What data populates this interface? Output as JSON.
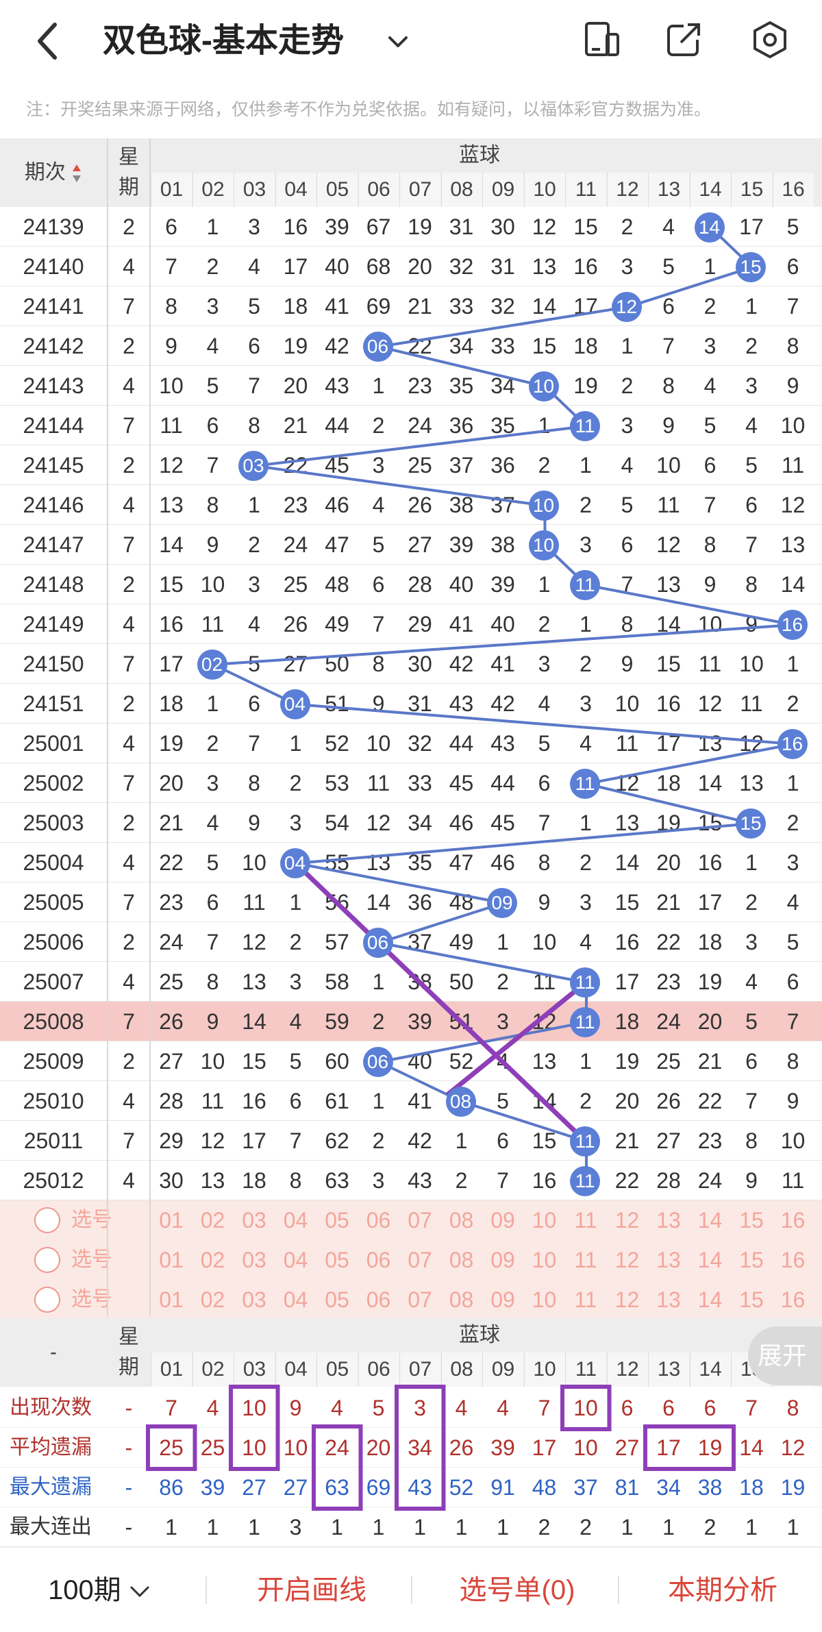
{
  "header": {
    "back_icon": "chevron-left-icon",
    "title": "双色球-基本走势",
    "dropdown_icon": "chevron-down-icon",
    "icons": [
      "phone-icon",
      "share-icon",
      "settings-icon"
    ]
  },
  "note": "注：开奖结果来源于网络，仅供参考不作为兑奖依据。如有疑问，以福体彩官方数据为准。",
  "table_header": {
    "period_label": "期次",
    "sort_icon": "sort-updown-icon",
    "weekday_label": [
      "星",
      "期"
    ],
    "blue_ball_label": "蓝球",
    "numbers": [
      "01",
      "02",
      "03",
      "04",
      "05",
      "06",
      "07",
      "08",
      "09",
      "10",
      "11",
      "12",
      "13",
      "14",
      "15",
      "16"
    ]
  },
  "rows": [
    {
      "period": "24139",
      "weekday": "2",
      "cells": [
        "6",
        "1",
        "3",
        "16",
        "39",
        "67",
        "19",
        "31",
        "30",
        "12",
        "15",
        "2",
        "4",
        "14",
        "17",
        "5"
      ],
      "hit": 14
    },
    {
      "period": "24140",
      "weekday": "4",
      "cells": [
        "7",
        "2",
        "4",
        "17",
        "40",
        "68",
        "20",
        "32",
        "31",
        "13",
        "16",
        "3",
        "5",
        "1",
        "15",
        "6"
      ],
      "hit": 15
    },
    {
      "period": "24141",
      "weekday": "7",
      "cells": [
        "8",
        "3",
        "5",
        "18",
        "41",
        "69",
        "21",
        "33",
        "32",
        "14",
        "17",
        "12",
        "6",
        "2",
        "1",
        "7"
      ],
      "hit": 12
    },
    {
      "period": "24142",
      "weekday": "2",
      "cells": [
        "9",
        "4",
        "6",
        "19",
        "42",
        "06",
        "22",
        "34",
        "33",
        "15",
        "18",
        "1",
        "7",
        "3",
        "2",
        "8"
      ],
      "hit": 6
    },
    {
      "period": "24143",
      "weekday": "4",
      "cells": [
        "10",
        "5",
        "7",
        "20",
        "43",
        "1",
        "23",
        "35",
        "34",
        "10",
        "19",
        "2",
        "8",
        "4",
        "3",
        "9"
      ],
      "hit": 10
    },
    {
      "period": "24144",
      "weekday": "7",
      "cells": [
        "11",
        "6",
        "8",
        "21",
        "44",
        "2",
        "24",
        "36",
        "35",
        "1",
        "11",
        "3",
        "9",
        "5",
        "4",
        "10"
      ],
      "hit": 11
    },
    {
      "period": "24145",
      "weekday": "2",
      "cells": [
        "12",
        "7",
        "03",
        "22",
        "45",
        "3",
        "25",
        "37",
        "36",
        "2",
        "1",
        "4",
        "10",
        "6",
        "5",
        "11"
      ],
      "hit": 3
    },
    {
      "period": "24146",
      "weekday": "4",
      "cells": [
        "13",
        "8",
        "1",
        "23",
        "46",
        "4",
        "26",
        "38",
        "37",
        "10",
        "2",
        "5",
        "11",
        "7",
        "6",
        "12"
      ],
      "hit": 10
    },
    {
      "period": "24147",
      "weekday": "7",
      "cells": [
        "14",
        "9",
        "2",
        "24",
        "47",
        "5",
        "27",
        "39",
        "38",
        "10",
        "3",
        "6",
        "12",
        "8",
        "7",
        "13"
      ],
      "hit": 10
    },
    {
      "period": "24148",
      "weekday": "2",
      "cells": [
        "15",
        "10",
        "3",
        "25",
        "48",
        "6",
        "28",
        "40",
        "39",
        "1",
        "11",
        "7",
        "13",
        "9",
        "8",
        "14"
      ],
      "hit": 11
    },
    {
      "period": "24149",
      "weekday": "4",
      "cells": [
        "16",
        "11",
        "4",
        "26",
        "49",
        "7",
        "29",
        "41",
        "40",
        "2",
        "1",
        "8",
        "14",
        "10",
        "9",
        "16"
      ],
      "hit": 16
    },
    {
      "period": "24150",
      "weekday": "7",
      "cells": [
        "17",
        "02",
        "5",
        "27",
        "50",
        "8",
        "30",
        "42",
        "41",
        "3",
        "2",
        "9",
        "15",
        "11",
        "10",
        "1"
      ],
      "hit": 2
    },
    {
      "period": "24151",
      "weekday": "2",
      "cells": [
        "18",
        "1",
        "6",
        "04",
        "51",
        "9",
        "31",
        "43",
        "42",
        "4",
        "3",
        "10",
        "16",
        "12",
        "11",
        "2"
      ],
      "hit": 4
    },
    {
      "period": "25001",
      "weekday": "4",
      "cells": [
        "19",
        "2",
        "7",
        "1",
        "52",
        "10",
        "32",
        "44",
        "43",
        "5",
        "4",
        "11",
        "17",
        "13",
        "12",
        "16"
      ],
      "hit": 16
    },
    {
      "period": "25002",
      "weekday": "7",
      "cells": [
        "20",
        "3",
        "8",
        "2",
        "53",
        "11",
        "33",
        "45",
        "44",
        "6",
        "11",
        "12",
        "18",
        "14",
        "13",
        "1"
      ],
      "hit": 11
    },
    {
      "period": "25003",
      "weekday": "2",
      "cells": [
        "21",
        "4",
        "9",
        "3",
        "54",
        "12",
        "34",
        "46",
        "45",
        "7",
        "1",
        "13",
        "19",
        "15",
        "15",
        "2"
      ],
      "hit": 15
    },
    {
      "period": "25004",
      "weekday": "4",
      "cells": [
        "22",
        "5",
        "10",
        "04",
        "55",
        "13",
        "35",
        "47",
        "46",
        "8",
        "2",
        "14",
        "20",
        "16",
        "1",
        "3"
      ],
      "hit": 4
    },
    {
      "period": "25005",
      "weekday": "7",
      "cells": [
        "23",
        "6",
        "11",
        "1",
        "56",
        "14",
        "36",
        "48",
        "09",
        "9",
        "3",
        "15",
        "21",
        "17",
        "2",
        "4"
      ],
      "hit": 9
    },
    {
      "period": "25006",
      "weekday": "2",
      "cells": [
        "24",
        "7",
        "12",
        "2",
        "57",
        "06",
        "37",
        "49",
        "1",
        "10",
        "4",
        "16",
        "22",
        "18",
        "3",
        "5"
      ],
      "hit": 6
    },
    {
      "period": "25007",
      "weekday": "4",
      "cells": [
        "25",
        "8",
        "13",
        "3",
        "58",
        "1",
        "38",
        "50",
        "2",
        "11",
        "11",
        "17",
        "23",
        "19",
        "4",
        "6"
      ],
      "hit": 11
    },
    {
      "period": "25008",
      "weekday": "7",
      "cells": [
        "26",
        "9",
        "14",
        "4",
        "59",
        "2",
        "39",
        "51",
        "3",
        "12",
        "11",
        "18",
        "24",
        "20",
        "5",
        "7"
      ],
      "hit": 11
    },
    {
      "period": "25009",
      "weekday": "2",
      "cells": [
        "27",
        "10",
        "15",
        "5",
        "60",
        "06",
        "40",
        "52",
        "4",
        "13",
        "1",
        "19",
        "25",
        "21",
        "6",
        "8"
      ],
      "hit": 6
    },
    {
      "period": "25010",
      "weekday": "4",
      "cells": [
        "28",
        "11",
        "16",
        "6",
        "61",
        "1",
        "41",
        "08",
        "5",
        "14",
        "2",
        "20",
        "26",
        "22",
        "7",
        "9"
      ],
      "hit": 8
    },
    {
      "period": "25011",
      "weekday": "7",
      "cells": [
        "29",
        "12",
        "17",
        "7",
        "62",
        "2",
        "42",
        "1",
        "6",
        "15",
        "11",
        "21",
        "27",
        "23",
        "8",
        "10"
      ],
      "hit": 11
    },
    {
      "period": "25012",
      "weekday": "4",
      "cells": [
        "30",
        "13",
        "18",
        "8",
        "63",
        "3",
        "43",
        "2",
        "7",
        "16",
        "11",
        "22",
        "28",
        "24",
        "9",
        "11"
      ],
      "hit": 11
    }
  ],
  "highlight_period": "25008",
  "select_rows": [
    {
      "label": "选号",
      "numbers": [
        "01",
        "02",
        "03",
        "04",
        "05",
        "06",
        "07",
        "08",
        "09",
        "10",
        "11",
        "12",
        "13",
        "14",
        "15",
        "16"
      ]
    },
    {
      "label": "选号",
      "numbers": [
        "01",
        "02",
        "03",
        "04",
        "05",
        "06",
        "07",
        "08",
        "09",
        "10",
        "11",
        "12",
        "13",
        "14",
        "15",
        "16"
      ]
    },
    {
      "label": "选号",
      "numbers": [
        "01",
        "02",
        "03",
        "04",
        "05",
        "06",
        "07",
        "08",
        "09",
        "10",
        "11",
        "12",
        "13",
        "14",
        "15",
        "16"
      ]
    }
  ],
  "stats_header": {
    "dash": "-",
    "weekday_label": [
      "星",
      "期"
    ],
    "blue_ball_label": "蓝球",
    "numbers": [
      "01",
      "02",
      "03",
      "04",
      "05",
      "06",
      "07",
      "08",
      "09",
      "10",
      "11",
      "12",
      "13",
      "14",
      "15",
      "16"
    ],
    "expand_label": "展开"
  },
  "stats": [
    {
      "label": "出现次数",
      "dash": "-",
      "values": [
        "7",
        "4",
        "10",
        "9",
        "4",
        "5",
        "3",
        "4",
        "4",
        "7",
        "10",
        "6",
        "6",
        "6",
        "7",
        "8"
      ],
      "color": "#b0312c"
    },
    {
      "label": "平均遗漏",
      "dash": "-",
      "values": [
        "25",
        "25",
        "10",
        "10",
        "24",
        "20",
        "34",
        "26",
        "39",
        "17",
        "10",
        "27",
        "17",
        "19",
        "14",
        "12"
      ],
      "color": "#b0312c"
    },
    {
      "label": "最大遗漏",
      "dash": "-",
      "values": [
        "86",
        "39",
        "27",
        "27",
        "63",
        "69",
        "43",
        "52",
        "91",
        "48",
        "37",
        "81",
        "34",
        "38",
        "18",
        "19"
      ],
      "color": "#2f63c4"
    },
    {
      "label": "最大连出",
      "dash": "-",
      "values": [
        "1",
        "1",
        "1",
        "3",
        "1",
        "1",
        "1",
        "1",
        "1",
        "2",
        "2",
        "1",
        "1",
        "2",
        "1",
        "1"
      ],
      "color": "#333333"
    }
  ],
  "colors": {
    "ball": "#5b7fd6",
    "line": "#5b78c8",
    "annotation": "#8e3fb8",
    "highlight_row": "#f6c9c6",
    "select_bg": "#fbe9e6"
  },
  "footer": {
    "periods_label": "100期",
    "periods_icon": "chevron-down-icon",
    "draw_line": "开启画线",
    "selection": "选号单(0)",
    "analysis": "本期分析"
  }
}
